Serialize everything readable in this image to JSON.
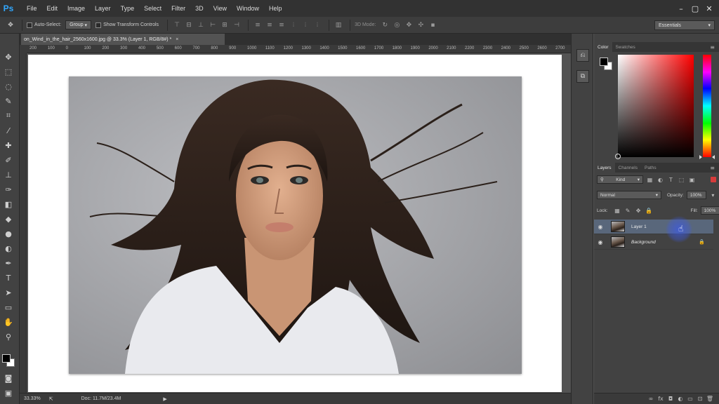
{
  "app": {
    "logo_text": "Ps",
    "menus": [
      "File",
      "Edit",
      "Image",
      "Layer",
      "Type",
      "Select",
      "Filter",
      "3D",
      "View",
      "Window",
      "Help"
    ],
    "window_controls": [
      "–",
      "▢",
      "✕"
    ]
  },
  "options_bar": {
    "auto_select_label": "Auto-Select:",
    "auto_select_value": "Group",
    "show_transform_label": "Show Transform Controls",
    "mode_3d_label": "3D Mode:",
    "workspace": "Essentials"
  },
  "document": {
    "tab_title": "on_Wind_in_the_hair_2560x1600.jpg @ 33.3% (Layer 1, RGB/8#) *",
    "tab_close": "×",
    "ruler_ticks": [
      "200",
      "100",
      "0",
      "100",
      "200",
      "300",
      "400",
      "500",
      "600",
      "700",
      "800",
      "900",
      "1000",
      "1100",
      "1200",
      "1300",
      "1400",
      "1500",
      "1600",
      "1700",
      "1800",
      "1900",
      "2000",
      "2100",
      "2200",
      "2300",
      "2400",
      "2500",
      "2600",
      "2700"
    ]
  },
  "status": {
    "zoom": "33.33%",
    "doc_info": "Doc: 11.7M/23.4M"
  },
  "color_panel": {
    "tabs": [
      "Color",
      "Swatches"
    ],
    "foreground": "#000000",
    "background": "#ffffff"
  },
  "layers_panel": {
    "tabs": [
      "Layers",
      "Channels",
      "Paths"
    ],
    "filter_kind": "Kind",
    "blend_mode": "Normal",
    "opacity_label": "Opacity:",
    "opacity_value": "100%",
    "lock_label": "Lock:",
    "fill_label": "Fill:",
    "fill_value": "100%",
    "layers": [
      {
        "name": "Layer 1",
        "visible": true,
        "selected": true,
        "locked": false
      },
      {
        "name": "Background",
        "visible": true,
        "selected": false,
        "locked": true
      }
    ]
  },
  "icons": {
    "eye": "eye-icon",
    "lock": "lock-icon",
    "link": "link-icon"
  },
  "colors": {
    "selected_layer": "#59677b",
    "ps_blue": "#31a8ff",
    "ui_dark": "#323232"
  }
}
